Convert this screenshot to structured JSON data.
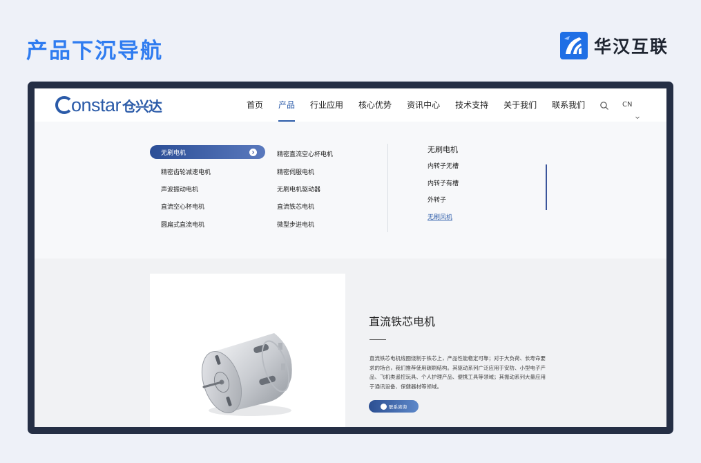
{
  "slide": {
    "title": "产品下沉导航"
  },
  "brand": {
    "name": "华汉互联",
    "icon": "brand-logo-icon",
    "color": "#1f6fe5"
  },
  "site": {
    "logo_text": "Constar",
    "logo_latin_rest": "onstar",
    "logo_cn": "仓兴达",
    "nav": [
      "首页",
      "产品",
      "行业应用",
      "核心优势",
      "资讯中心",
      "技术支持",
      "关于我们",
      "联系我们"
    ],
    "active_nav": "产品",
    "search_icon": "search-icon",
    "lang": "CN",
    "accent": "#2a5aa8"
  },
  "megamenu": {
    "col1": [
      "无刷电机",
      "精密齿轮减速电机",
      "声波振动电机",
      "直流空心杯电机",
      "圆扁式直流电机"
    ],
    "col2": [
      "精密直流空心杯电机",
      "精密伺服电机",
      "无刷电机驱动器",
      "直流铁芯电机",
      "微型步进电机"
    ],
    "selected": "无刷电机",
    "sub_title": "无刷电机",
    "sub_items": [
      "内转子无槽",
      "内转子有槽",
      "外转子",
      "无刷风机"
    ],
    "sub_current": "无刷风机"
  },
  "product": {
    "title": "直流铁芯电机",
    "description": "直流铁芯电机线圈绕制于铁芯上，产品性能稳定可靠；对于大负荷、长寿命要求的场合，我们推荐使用碳刷结构。其驱动系列广泛应用于安防、小型电子产品、飞机类遥控玩具、个人护理产品、便携工具等领域；其振动系列大量应用于通讯设备、保健器材等领域。",
    "button": "联系咨询"
  }
}
